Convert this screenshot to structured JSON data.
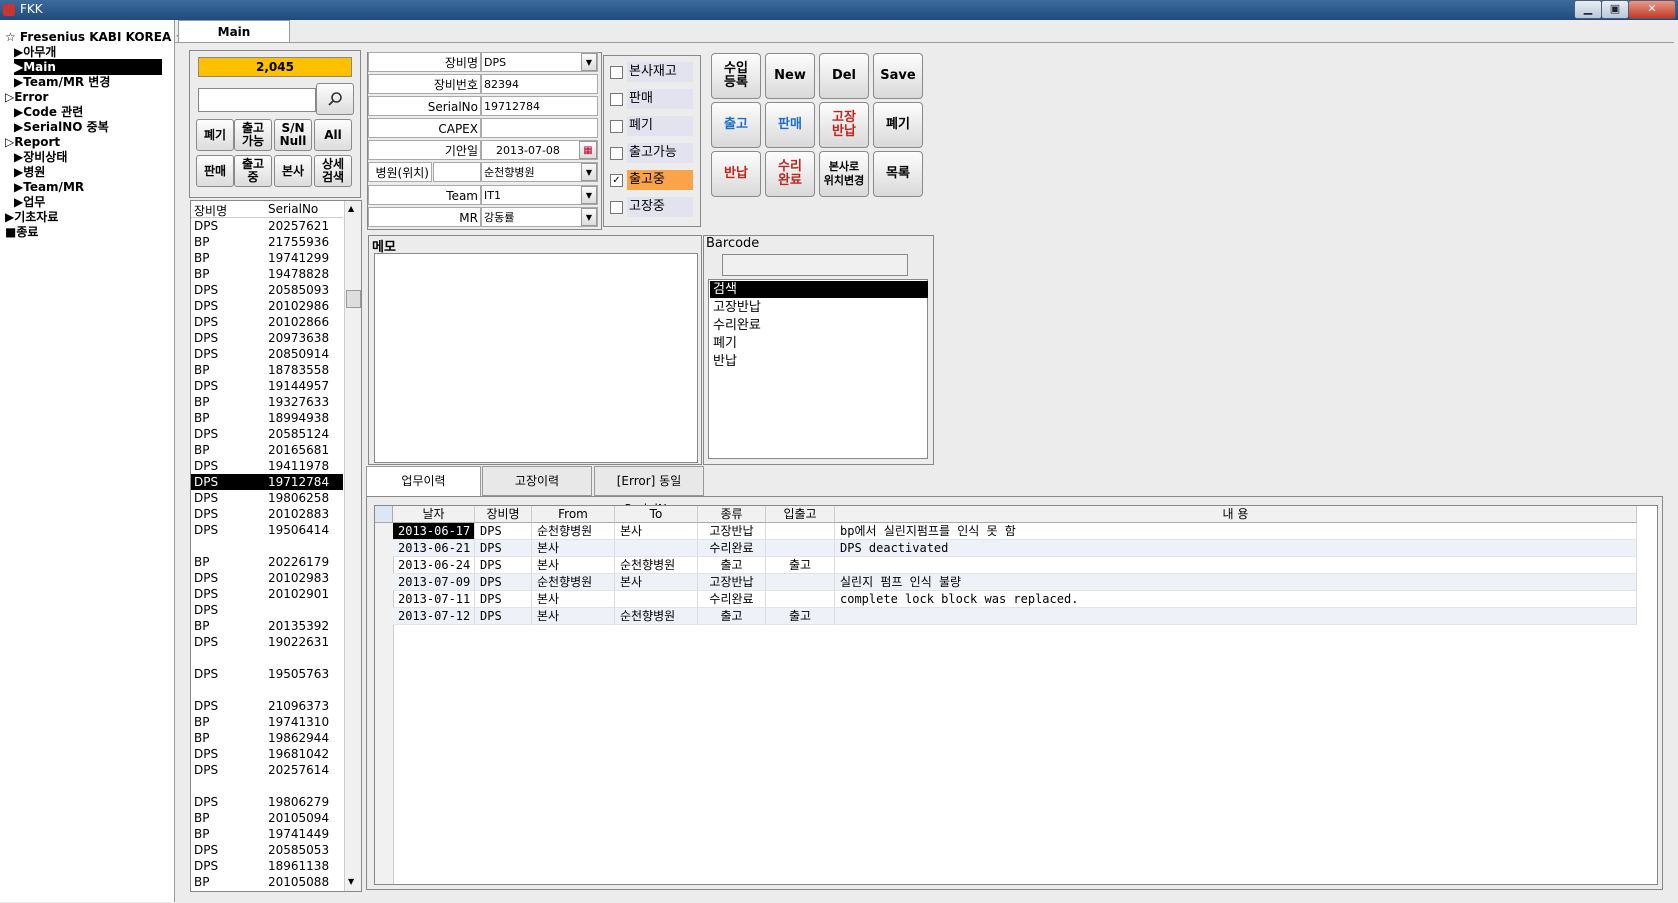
{
  "window": {
    "title": "FKK",
    "tab": "Main"
  },
  "nav": [
    {
      "label": "☆ Fresenius KABI KOREA ☆"
    },
    {
      "label": "▶아무개"
    },
    {
      "label": "▶Main"
    },
    {
      "label": "▶Team/MR 변경"
    },
    {
      "label": "▷Error"
    },
    {
      "label": "▶Code 관련"
    },
    {
      "label": "▶SerialNO 중복"
    },
    {
      "label": "▷Report"
    },
    {
      "label": "▶장비상태"
    },
    {
      "label": "▶병원"
    },
    {
      "label": "▶Team/MR"
    },
    {
      "label": "▶업무"
    },
    {
      "label": "▶기초자료"
    },
    {
      "label": "■종료"
    }
  ],
  "counter": "2,045",
  "search": {
    "value": ""
  },
  "filter_buttons": [
    "폐기",
    "출고\n가능",
    "S/N\nNull",
    "All",
    "판매",
    "출고\n중",
    "본사",
    "상세\n검색"
  ],
  "list": {
    "headers": [
      "장비명",
      "SerialNo"
    ],
    "rows": [
      [
        "DPS",
        "20257621"
      ],
      [
        "BP",
        "21755936"
      ],
      [
        "BP",
        "19741299"
      ],
      [
        "BP",
        "19478828"
      ],
      [
        "DPS",
        "20585093"
      ],
      [
        "DPS",
        "20102986"
      ],
      [
        "DPS",
        "20102866"
      ],
      [
        "DPS",
        "20973638"
      ],
      [
        "DPS",
        "20850914"
      ],
      [
        "BP",
        "18783558"
      ],
      [
        "DPS",
        "19144957"
      ],
      [
        "BP",
        "19327633"
      ],
      [
        "BP",
        "18994938"
      ],
      [
        "DPS",
        "20585124"
      ],
      [
        "BP",
        "20165681"
      ],
      [
        "DPS",
        "19411978"
      ],
      [
        "DPS",
        "19712784"
      ],
      [
        "DPS",
        "19806258"
      ],
      [
        "DPS",
        "20102883"
      ],
      [
        "DPS",
        "19506414"
      ],
      [
        "",
        ""
      ],
      [
        "BP",
        "20226179"
      ],
      [
        "DPS",
        "20102983"
      ],
      [
        "DPS",
        "20102901"
      ],
      [
        "DPS",
        ""
      ],
      [
        "BP",
        "20135392"
      ],
      [
        "DPS",
        "19022631"
      ],
      [
        "",
        ""
      ],
      [
        "DPS",
        "19505763"
      ],
      [
        "",
        ""
      ],
      [
        "DPS",
        "21096373"
      ],
      [
        "BP",
        "19741310"
      ],
      [
        "BP",
        "19862944"
      ],
      [
        "DPS",
        "19681042"
      ],
      [
        "DPS",
        "20257614"
      ],
      [
        "",
        ""
      ],
      [
        "DPS",
        "19806279"
      ],
      [
        "BP",
        "20105094"
      ],
      [
        "BP",
        "19741449"
      ],
      [
        "DPS",
        "20585053"
      ],
      [
        "DPS",
        "18961138"
      ],
      [
        "BP",
        "20105088"
      ]
    ],
    "selected_index": 16
  },
  "form": {
    "equipment_name": {
      "label": "장비명",
      "value": "DPS"
    },
    "equipment_no": {
      "label": "장비번호",
      "value": "82394"
    },
    "serial": {
      "label": "SerialNo",
      "value": "19712784"
    },
    "capex": {
      "label": "CAPEX",
      "value": ""
    },
    "date": {
      "label": "기안일",
      "value": "2013-07-08"
    },
    "hospital": {
      "label": "병원(위치)",
      "value": "순천향병원"
    },
    "team": {
      "label": "Team",
      "value": "IT1"
    },
    "mr": {
      "label": "MR",
      "value": "강동률"
    }
  },
  "status_checks": [
    {
      "label": "본사재고",
      "checked": false
    },
    {
      "label": "판매",
      "checked": false
    },
    {
      "label": "폐기",
      "checked": false
    },
    {
      "label": "출고가능",
      "checked": false
    },
    {
      "label": "출고중",
      "checked": true
    },
    {
      "label": "고장중",
      "checked": false
    }
  ],
  "actions": {
    "import": "수입\n등록",
    "new": "New",
    "del": "Del",
    "save": "Save",
    "ship": "출고",
    "sell": "판매",
    "broken_return": "고장\n반납",
    "dispose": "폐기",
    "return": "반납",
    "repaired": "수리\n완료",
    "relocate": "본사로\n위치변경",
    "list": "목록"
  },
  "memo": {
    "label": "메모",
    "value": ""
  },
  "barcode": {
    "label": "Barcode",
    "input": "",
    "items": [
      "검색",
      "고장반납",
      "수리완료",
      "폐기",
      "반납"
    ],
    "selected_index": 0
  },
  "bottom_tabs": [
    "업무이력",
    "고장이력",
    "[Error] 동일SerialNo"
  ],
  "history": {
    "headers": [
      "날자",
      "장비명",
      "From",
      "To",
      "종류",
      "입출고",
      "내 용"
    ],
    "rows": [
      [
        "2013-06-17",
        "DPS",
        "순천향병원",
        "본사",
        "고장반납",
        "",
        "bp에서 실린지펌프를 인식 못 함"
      ],
      [
        "2013-06-21",
        "DPS",
        "본사",
        "",
        "수리완료",
        "",
        "DPS deactivated"
      ],
      [
        "2013-06-24",
        "DPS",
        "본사",
        "순천향병원",
        "출고",
        "출고",
        ""
      ],
      [
        "2013-07-09",
        "DPS",
        "순천향병원",
        "본사",
        "고장반납",
        "",
        "실린지 펌프 인식 불량"
      ],
      [
        "2013-07-11",
        "DPS",
        "본사",
        "",
        "수리완료",
        "",
        "complete lock block was replaced."
      ],
      [
        "2013-07-12",
        "DPS",
        "본사",
        "순천향병원",
        "출고",
        "출고",
        ""
      ]
    ]
  }
}
